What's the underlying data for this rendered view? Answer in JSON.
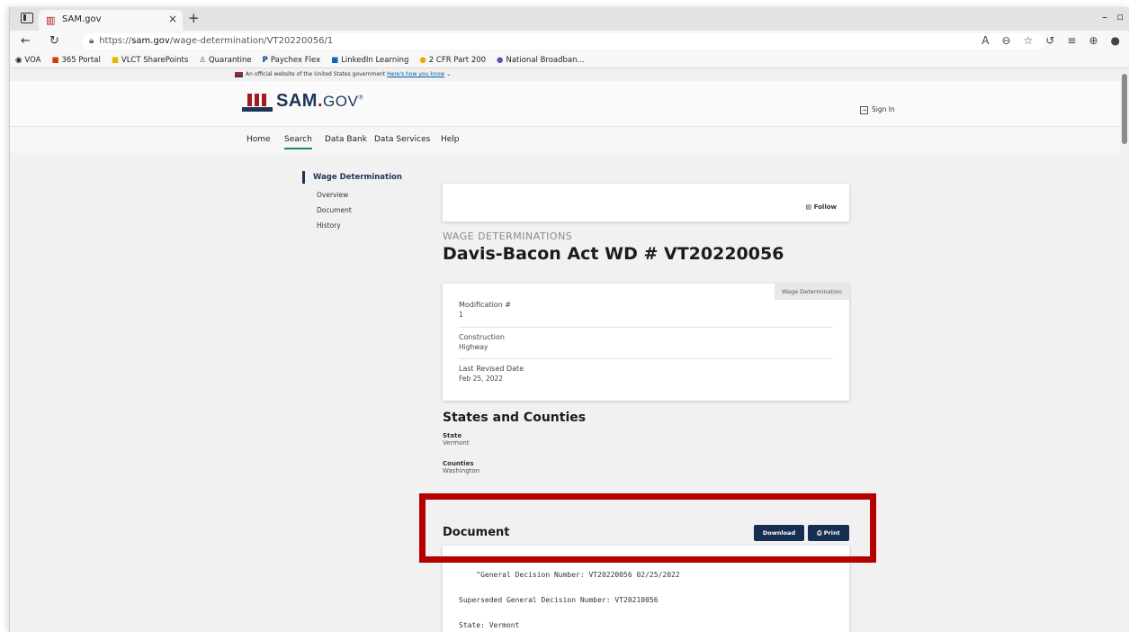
{
  "browser": {
    "tab_title": "SAM.gov",
    "url_prefix": "https://",
    "url_host": "sam.gov",
    "url_path": "/wage-determination/VT20220056/1",
    "bookmarks": [
      "VOA",
      "365 Portal",
      "VLCT SharePoints",
      "Quarantine",
      "Paychex Flex",
      "LinkedIn Learning",
      "2 CFR Part 200",
      "National Broadban..."
    ]
  },
  "banner": {
    "text": "An official website of the United States government",
    "link": "Here's how you know"
  },
  "header": {
    "logo_sam": "SAM",
    "logo_dot": ".",
    "logo_gov": "GOV",
    "logo_reg": "®",
    "signin": "Sign In"
  },
  "nav": [
    "Home",
    "Search",
    "Data Bank",
    "Data Services",
    "Help"
  ],
  "sidenav": {
    "current": "Wage Determination",
    "items": [
      "Overview",
      "Document",
      "History"
    ]
  },
  "follow": "Follow",
  "eyebrow": "WAGE DETERMINATIONS",
  "title": "Davis-Bacon Act WD # VT20220056",
  "info_card": {
    "tag": "Wage Determination",
    "fields": [
      {
        "label": "Modification #",
        "value": "1"
      },
      {
        "label": "Construction",
        "value": "Highway"
      },
      {
        "label": "Last Revised Date",
        "value": "Feb 25, 2022"
      }
    ]
  },
  "states": {
    "heading": "States and Counties",
    "state_label": "State",
    "state_value": "Vermont",
    "counties_label": "Counties",
    "counties_value": "Washington"
  },
  "document": {
    "heading": "Document",
    "download": "Download",
    "print": "Print",
    "lines": [
      "    \"General Decision Number: VT20220056 02/25/2022",
      "Superseded General Decision Number: VT20210056",
      "State: Vermont"
    ]
  },
  "colors": {
    "highlight": "#b40000",
    "navy": "#162e51",
    "brand_red": "#a31a22"
  }
}
